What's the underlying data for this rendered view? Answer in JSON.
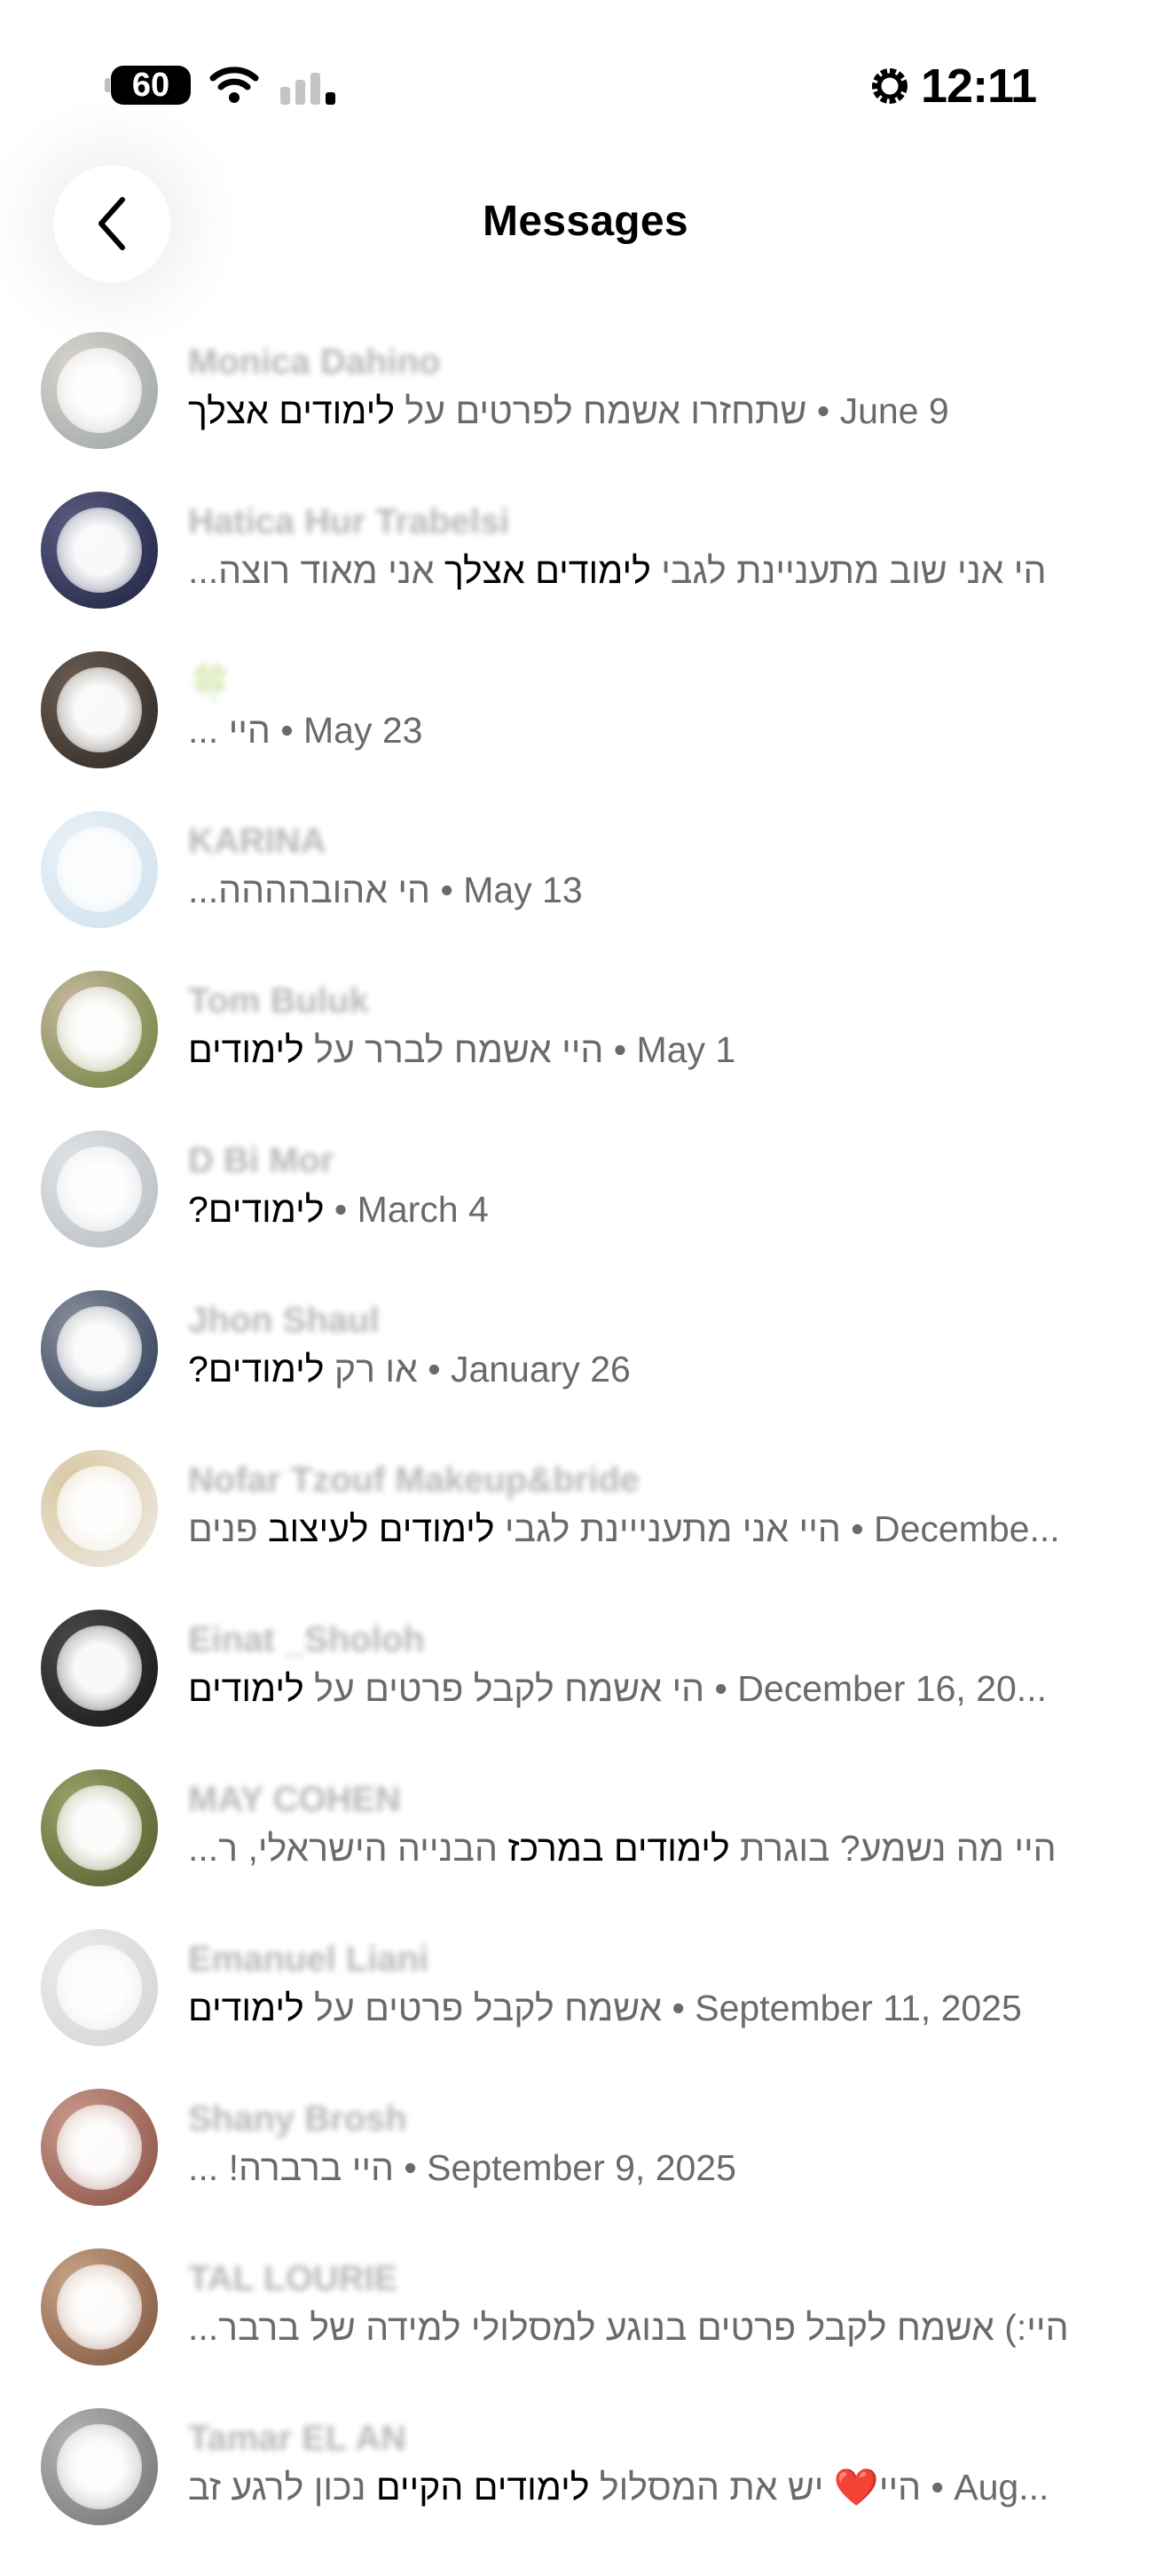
{
  "status": {
    "battery": "60",
    "time": "12:11"
  },
  "header": {
    "title": "Messages"
  },
  "conversations": [
    {
      "name": "Monica Dahino",
      "date": "June 9",
      "before": "שתחזרו אשמח לפרטים על ",
      "highlight": "לימודים אצלך",
      "after": "",
      "avatar_colors": [
        "#9aa3a6",
        "#d9d4cc"
      ]
    },
    {
      "name": "Hatica Hur Trabelsi",
      "date": "",
      "before": "הי אני שוב מתעניינת לגבי ",
      "highlight": "לימודים אצלך",
      "after": " אני מאוד רוצה...",
      "avatar_colors": [
        "#1d2140",
        "#5a5d80"
      ]
    },
    {
      "name": "🍀",
      "date": "May 23",
      "before": "היי ...",
      "highlight": "",
      "after": "",
      "avatar_colors": [
        "#2b2622",
        "#6b5d52"
      ]
    },
    {
      "name": "KARINA",
      "date": "May 13",
      "before": "הי אהובהההה...",
      "highlight": "",
      "after": "",
      "avatar_colors": [
        "#cfe1ee",
        "#e9f1f6"
      ]
    },
    {
      "name": "Tom Buluk",
      "date": "May 1",
      "before": "היי אשמח לברר על ",
      "highlight": "לימודים",
      "after": "",
      "avatar_colors": [
        "#6b7f3a",
        "#c8b9a0"
      ]
    },
    {
      "name": "D Bi Mor",
      "date": "March 4",
      "before": "",
      "highlight": "לימודים?",
      "after": "",
      "avatar_colors": [
        "#b7bcc2",
        "#e0e3e6"
      ]
    },
    {
      "name": "Jhon Shaul",
      "date": "January 26",
      "before": "או רק ",
      "highlight": "לימודים?",
      "after": "",
      "avatar_colors": [
        "#2a3a55",
        "#8a8f9a"
      ]
    },
    {
      "name": "Nofar Tzouf Makeup&bride",
      "date": "Decembe...",
      "before": "היי אני מתענייינת לגבי ",
      "highlight": "לימודים לעיצוב",
      "after": " פנים",
      "avatar_colors": [
        "#efece6",
        "#d8c7a0"
      ]
    },
    {
      "name": "Einat _Sholoh",
      "date": "December 16, 20...",
      "before": "הי אשמח לקבל פרטים על ",
      "highlight": "לימודים",
      "after": "",
      "avatar_colors": [
        "#141414",
        "#4a4a4a"
      ]
    },
    {
      "name": "MAY COHEN",
      "date": "",
      "before": "היי מה נשמע? בוגרת ",
      "highlight": "לימודים במרכז",
      "after": " הבנייה הישראלי, ר...",
      "avatar_colors": [
        "#4f5a2a",
        "#9aa36a"
      ]
    },
    {
      "name": "Emanuel Liani",
      "date": "September 11, 2025",
      "before": "אשמח לקבל פרטים על ",
      "highlight": "לימודים",
      "after": "",
      "avatar_colors": [
        "#d3d3d6",
        "#ececee"
      ]
    },
    {
      "name": "Shany Brosh",
      "date": "September 9, 2025",
      "before": "היי ברברה! ...",
      "highlight": "",
      "after": "",
      "avatar_colors": [
        "#8a4e44",
        "#c79a8a"
      ]
    },
    {
      "name": "TAL LOURIE",
      "date": "",
      "before": "היי:) אשמח לקבל פרטים בנוגע למסלולי למידה של ברבר...",
      "highlight": "",
      "after": "",
      "avatar_colors": [
        "#7a5038",
        "#c9a58a"
      ]
    },
    {
      "name": "Tamar EL AN",
      "date": "Aug...",
      "before": "היי❤️ יש את המסלול ",
      "highlight": "לימודים הקיים",
      "after": " נכון לרגע זב",
      "avatar_colors": [
        "#707070",
        "#b5b5b5"
      ]
    }
  ]
}
